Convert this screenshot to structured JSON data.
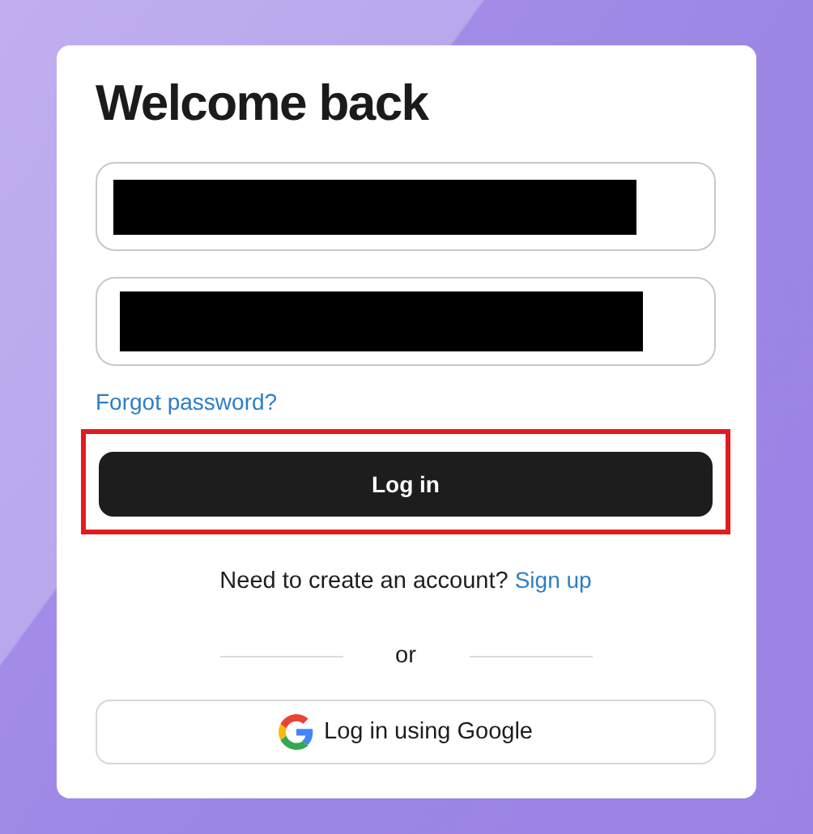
{
  "title": "Welcome back",
  "fields": [
    {
      "redacted": true
    },
    {
      "redacted": true
    }
  ],
  "forgot_link": "Forgot password?",
  "login_button": {
    "label": "Log in",
    "highlighted": true
  },
  "signup_prompt": {
    "text": "Need to create an account?",
    "link": "Sign up"
  },
  "separator": "or",
  "google_button": {
    "label": "Log in using Google"
  }
}
